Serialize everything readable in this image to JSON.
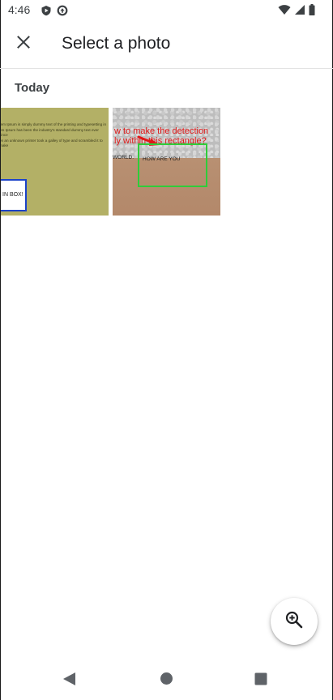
{
  "status_bar": {
    "time": "4:46",
    "left_icons": [
      "play-protect-icon",
      "data-saver-icon"
    ],
    "right_icons": [
      "wifi-icon",
      "cellular-signal-icon",
      "battery-icon"
    ]
  },
  "app_bar": {
    "close_icon": "close-icon",
    "title": "Select a photo"
  },
  "section": {
    "header": "Today"
  },
  "photos": [
    {
      "text_lines": "rem Ipsum is simply dummy text of the printing and typesetting in\nem Ipsum has been the industry's standard dummy text ever since\nen an unknown printer took a galley of type and scrambled it to make",
      "box_label": "IN BOX!",
      "colors": {
        "background": "#b3b066",
        "box_border": "#1c43c9"
      }
    },
    {
      "caption": "w to make the detection\nly within this rectangle?",
      "word_left": "WORLD.",
      "word_right": "HOW ARE YOU",
      "colors": {
        "caption": "#e01818",
        "rectangle": "#2fcc3a"
      }
    }
  ],
  "fab": {
    "icon": "zoom-in-icon"
  },
  "nav_bar": {
    "icons": [
      "back-icon",
      "home-icon",
      "recents-icon"
    ]
  }
}
